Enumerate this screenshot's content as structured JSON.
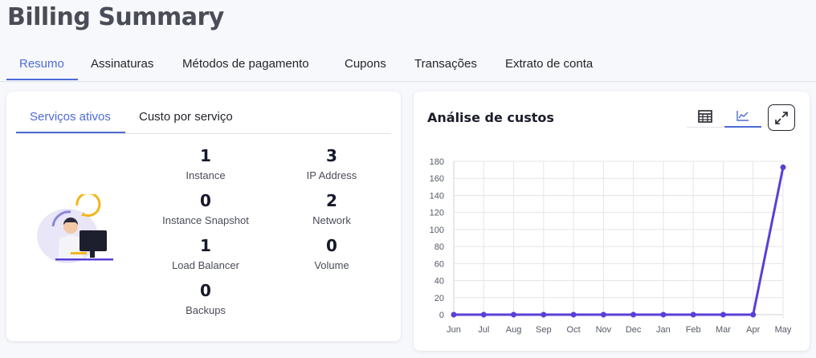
{
  "page": {
    "title": "Billing Summary"
  },
  "tabs": [
    {
      "label": "Resumo",
      "active": true
    },
    {
      "label": "Assinaturas"
    },
    {
      "label": "Métodos de pagamento"
    },
    {
      "label": "Cupons"
    },
    {
      "label": "Transações"
    },
    {
      "label": "Extrato de conta"
    }
  ],
  "services": {
    "subtabs": [
      {
        "label": "Serviços ativos",
        "active": true
      },
      {
        "label": "Custo por serviço"
      }
    ],
    "stats": [
      {
        "value": "1",
        "label": "Instance"
      },
      {
        "value": "3",
        "label": "IP Address"
      },
      {
        "value": "0",
        "label": "Instance Snapshot"
      },
      {
        "value": "2",
        "label": "Network"
      },
      {
        "value": "1",
        "label": "Load Balancer"
      },
      {
        "value": "0",
        "label": "Volume"
      },
      {
        "value": "0",
        "label": "Backups"
      }
    ]
  },
  "costs": {
    "title": "Análise de custos",
    "icons": {
      "table": "table-grid-icon",
      "line": "line-chart-icon",
      "expand": "expand-icon"
    }
  },
  "colors": {
    "accent": "#4f6bd6",
    "series": "#5b3fd6"
  },
  "chart_data": {
    "type": "line",
    "title": "",
    "xlabel": "",
    "ylabel": "",
    "categories": [
      "Jun",
      "Jul",
      "Aug",
      "Sep",
      "Oct",
      "Nov",
      "Dec",
      "Jan",
      "Feb",
      "Mar",
      "Apr",
      "May"
    ],
    "values": [
      0,
      0,
      0,
      0,
      0,
      0,
      0,
      0,
      0,
      0,
      0,
      173
    ],
    "ylim": [
      0,
      180
    ],
    "yticks": [
      0,
      20,
      40,
      60,
      80,
      100,
      120,
      140,
      160,
      180
    ],
    "grid": true,
    "legend": "none"
  }
}
